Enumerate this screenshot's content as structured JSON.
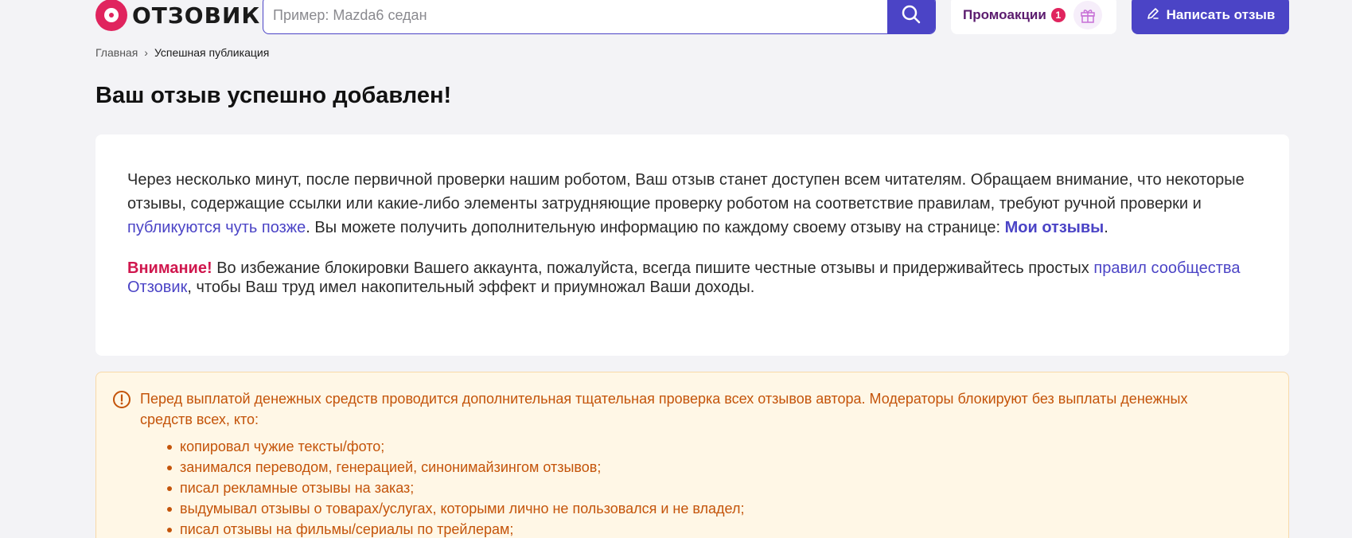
{
  "header": {
    "logo_text": "ОТЗОВИК",
    "search_placeholder": "Пример: Mazda6 седан",
    "promo_label": "Промоакции",
    "promo_count": "1",
    "write_review_label": "Написать отзыв"
  },
  "breadcrumb": {
    "home": "Главная",
    "separator": "›",
    "current": "Успешная публикация"
  },
  "page_title": "Ваш отзыв успешно добавлен!",
  "card": {
    "p1_text_1": "Через несколько минут, после первичной проверки нашим роботом, Ваш отзыв станет доступен всем читателям. Обращаем внимание, что некоторые отзывы, содержащие ссылки или какие-либо элементы затрудняющие проверку роботом на соответствие правилам, требуют ручной проверки и ",
    "p1_link": "публикуются чуть позже",
    "p1_text_2": ". Вы можете получить дополнительную информацию по каждому своему отзыву на странице: ",
    "my_reviews_link": "Мои отзывы",
    "p1_end": ".",
    "warning_label": "Внимание!",
    "p2_text_1": " Во избежание блокировки Вашего аккаунта, пожалуйста, всегда пишите честные отзывы и придерживайтесь простых ",
    "rules_link": "правил сообщества Отзовик",
    "p2_text_2": ", чтобы Ваш труд имел накопительный эффект и приумножал Ваши доходы."
  },
  "notice": {
    "intro": "Перед выплатой денежных средств проводится дополнительная тщательная проверка всех отзывов автора. Модераторы блокируют без выплаты денежных средств всех, кто:",
    "items": [
      "копировал чужие тексты/фото;",
      "занимался переводом, генерацией, синонимайзингом отзывов;",
      "писал рекламные отзывы на заказ;",
      "выдумывал отзывы о товарах/услугах, которыми лично не пользовался и не владел;",
      "писал отзывы на фильмы/сериалы по трейлерам;"
    ]
  },
  "colors": {
    "brand": "#4b44c6",
    "accent_pink": "#e0245e",
    "notice_text": "#c4540a",
    "notice_bg": "#fff7e6"
  },
  "icons": {
    "search": "search-icon",
    "gift": "gift-icon",
    "pencil": "pencil-icon",
    "alert": "alert-circle-icon"
  }
}
